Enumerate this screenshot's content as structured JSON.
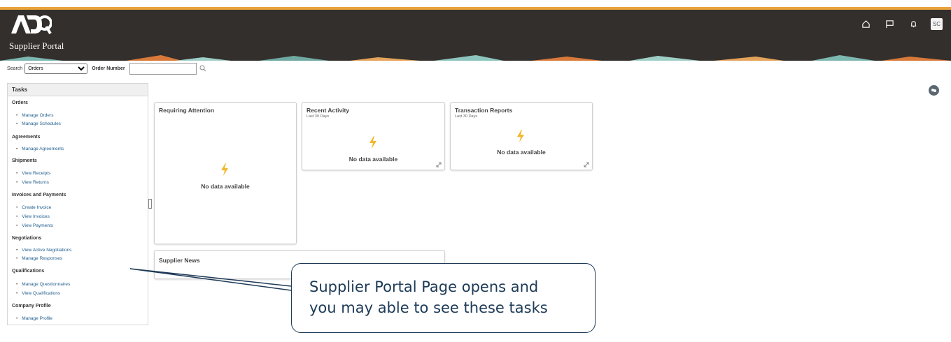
{
  "header": {
    "portal_title": "Supplier Portal",
    "logo_text": "ADQ",
    "avatar_initials": "SC",
    "icons": [
      "home-icon",
      "flag-icon",
      "bell-icon"
    ]
  },
  "search": {
    "label": "Search",
    "select_value": "Orders",
    "order_number_label": "Order Number",
    "order_number_value": ""
  },
  "tasks": {
    "title": "Tasks",
    "sections": [
      {
        "name": "Orders",
        "links": [
          "Manage Orders",
          "Manage Schedules"
        ]
      },
      {
        "name": "Agreements",
        "links": [
          "Manage Agreements"
        ]
      },
      {
        "name": "Shipments",
        "links": [
          "View Receipts",
          "View Returns"
        ]
      },
      {
        "name": "Invoices and Payments",
        "links": [
          "Create Invoice",
          "View Invoices",
          "View Payments"
        ]
      },
      {
        "name": "Negotiations",
        "links": [
          "View Active Negotiations",
          "Manage Responses"
        ]
      },
      {
        "name": "Qualifications",
        "links": [
          "Manage Questionnaires",
          "View Qualifications"
        ]
      },
      {
        "name": "Company Profile",
        "links": [
          "Manage Profile"
        ]
      }
    ]
  },
  "cards": {
    "requiring_attention": {
      "title": "Requiring Attention",
      "empty": "No data available"
    },
    "recent_activity": {
      "title": "Recent Activity",
      "subtitle": "Last 30 Days",
      "empty": "No data available"
    },
    "transaction_reports": {
      "title": "Transaction Reports",
      "subtitle": "Last 30 Days",
      "empty": "No data available"
    },
    "supplier_news": {
      "title": "Supplier News"
    }
  },
  "callout": {
    "line1": "Supplier Portal Page opens and",
    "line2": "you may able to see these tasks"
  },
  "colors": {
    "header_bg": "#332f2c",
    "accent_stripe": "#e8a33a",
    "link": "#1f5c8c",
    "bolt": "#f2b82e",
    "callout_border": "#1d3a57"
  }
}
